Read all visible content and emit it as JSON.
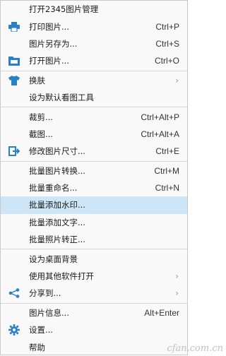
{
  "menu": {
    "items": [
      {
        "label": "打开2345图片管理",
        "shortcut": "",
        "icon": ""
      },
      {
        "label": "打印图片...",
        "shortcut": "Ctrl+P",
        "icon": "printer-icon"
      },
      {
        "label": "图片另存为...",
        "shortcut": "Ctrl+S",
        "icon": ""
      },
      {
        "label": "打开图片...",
        "shortcut": "Ctrl+O",
        "icon": "folder-open-icon"
      },
      {
        "label": "换肤",
        "shortcut": "",
        "icon": "tshirt-icon",
        "submenu": true
      },
      {
        "label": "设为默认看图工具",
        "shortcut": "",
        "icon": ""
      },
      {
        "label": "裁剪...",
        "shortcut": "Ctrl+Alt+P",
        "icon": ""
      },
      {
        "label": "截图...",
        "shortcut": "Ctrl+Alt+A",
        "icon": ""
      },
      {
        "label": "修改图片尺寸...",
        "shortcut": "Ctrl+E",
        "icon": "resize-icon"
      },
      {
        "label": "批量图片转换...",
        "shortcut": "Ctrl+M",
        "icon": ""
      },
      {
        "label": "批量重命名...",
        "shortcut": "Ctrl+N",
        "icon": ""
      },
      {
        "label": "批量添加水印...",
        "shortcut": "",
        "icon": "",
        "highlighted": true
      },
      {
        "label": "批量添加文字...",
        "shortcut": "",
        "icon": ""
      },
      {
        "label": "批量照片转正...",
        "shortcut": "",
        "icon": ""
      },
      {
        "label": "设为桌面背景",
        "shortcut": "",
        "icon": ""
      },
      {
        "label": "使用其他软件打开",
        "shortcut": "",
        "icon": "",
        "submenu": true
      },
      {
        "label": "分享到...",
        "shortcut": "",
        "icon": "share-icon",
        "submenu": true
      },
      {
        "label": "图片信息...",
        "shortcut": "Alt+Enter",
        "icon": ""
      },
      {
        "label": "设置...",
        "shortcut": "",
        "icon": "gear-icon"
      },
      {
        "label": "帮助",
        "shortcut": "",
        "icon": ""
      }
    ]
  },
  "watermark": "cfan.com.cn",
  "colors": {
    "highlight": "#cde6f7",
    "icon_blue": "#2a7fc9"
  }
}
